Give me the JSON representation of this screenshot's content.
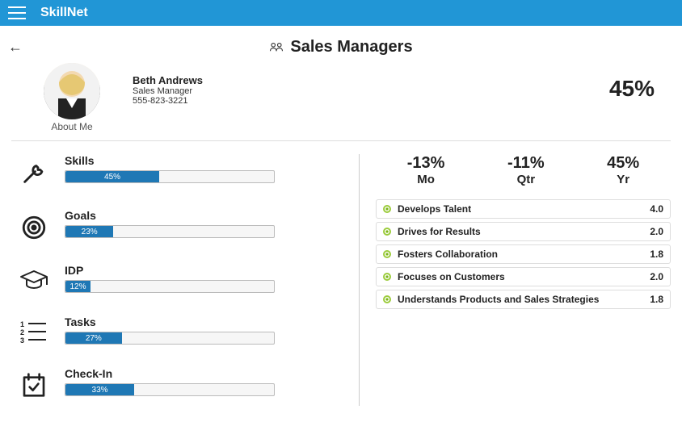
{
  "app": {
    "brand": "SkillNet"
  },
  "page": {
    "title": "Sales Managers"
  },
  "profile": {
    "name": "Beth Andrews",
    "role": "Sales Manager",
    "phone": "555-823-3221",
    "about_label": "About Me",
    "overall_pct": "45%"
  },
  "metrics": {
    "skills": {
      "label": "Skills",
      "pct": 45,
      "text": "45%"
    },
    "goals": {
      "label": "Goals",
      "pct": 23,
      "text": "23%"
    },
    "idp": {
      "label": "IDP",
      "pct": 12,
      "text": "12%"
    },
    "tasks": {
      "label": "Tasks",
      "pct": 27,
      "text": "27%"
    },
    "checkin": {
      "label": "Check-In",
      "pct": 33,
      "text": "33%"
    }
  },
  "period_stats": {
    "mo": {
      "value": "-13%",
      "label": "Mo"
    },
    "qtr": {
      "value": "-11%",
      "label": "Qtr"
    },
    "yr": {
      "value": "45%",
      "label": "Yr"
    }
  },
  "competencies": [
    {
      "name": "Develops Talent",
      "score": "4.0"
    },
    {
      "name": "Drives for Results",
      "score": "2.0"
    },
    {
      "name": "Fosters Collaboration",
      "score": "1.8"
    },
    {
      "name": "Focuses on Customers",
      "score": "2.0"
    },
    {
      "name": "Understands Products and Sales Strategies",
      "score": "1.8"
    }
  ]
}
